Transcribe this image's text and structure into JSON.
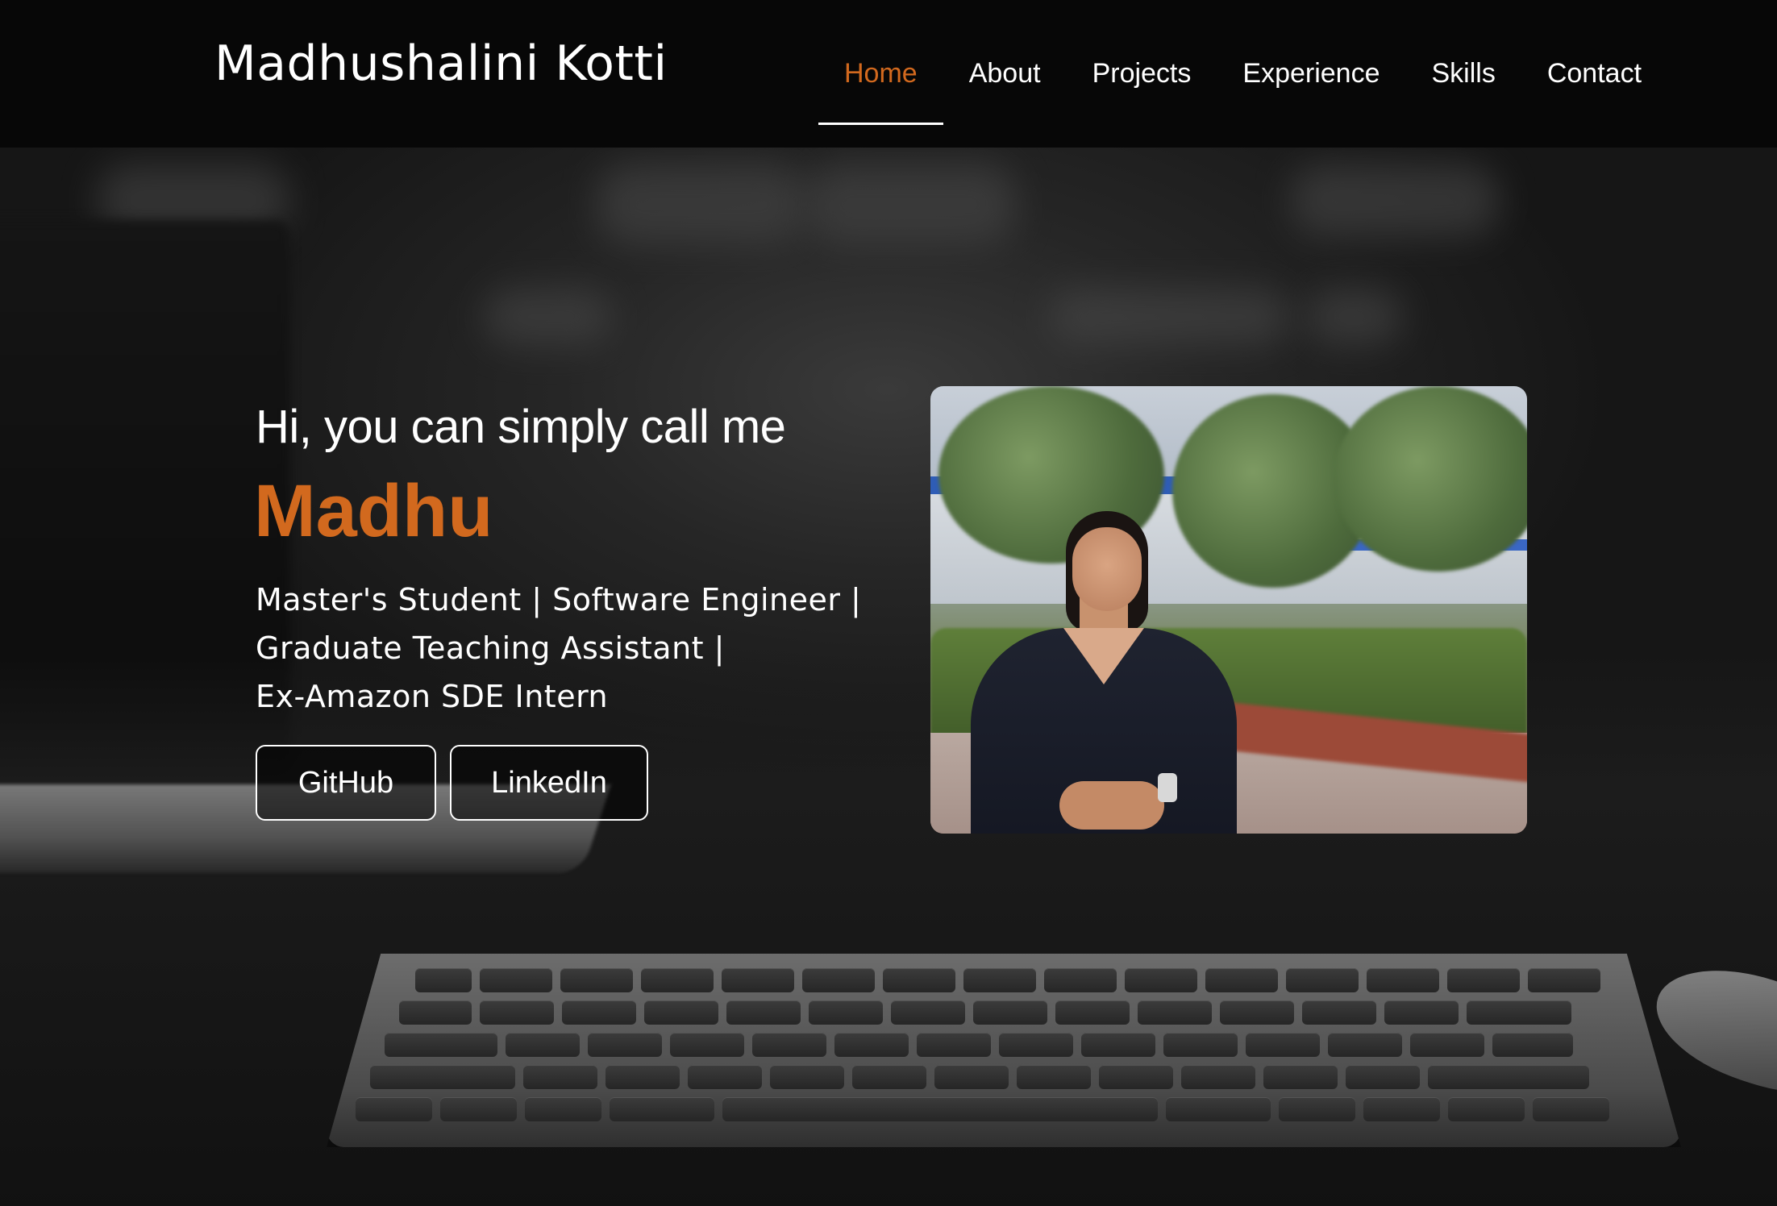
{
  "navbar": {
    "brand": "Madhushalini Kotti",
    "links": [
      {
        "label": "Home",
        "active": true
      },
      {
        "label": "About",
        "active": false
      },
      {
        "label": "Projects",
        "active": false
      },
      {
        "label": "Experience",
        "active": false
      },
      {
        "label": "Skills",
        "active": false
      },
      {
        "label": "Contact",
        "active": false
      }
    ]
  },
  "hero": {
    "greeting": "Hi, you can simply call me",
    "nickname": "Madhu",
    "tagline": [
      "Master's Student | Software Engineer |",
      "Graduate Teaching Assistant |",
      "Ex-Amazon SDE Intern"
    ],
    "buttons": {
      "github": "GitHub",
      "linkedin": "LinkedIn"
    },
    "photo_icon": "profile-photo"
  },
  "colors": {
    "accent": "#d2691e",
    "navbar_bg": "#070707",
    "text": "#ffffff"
  }
}
